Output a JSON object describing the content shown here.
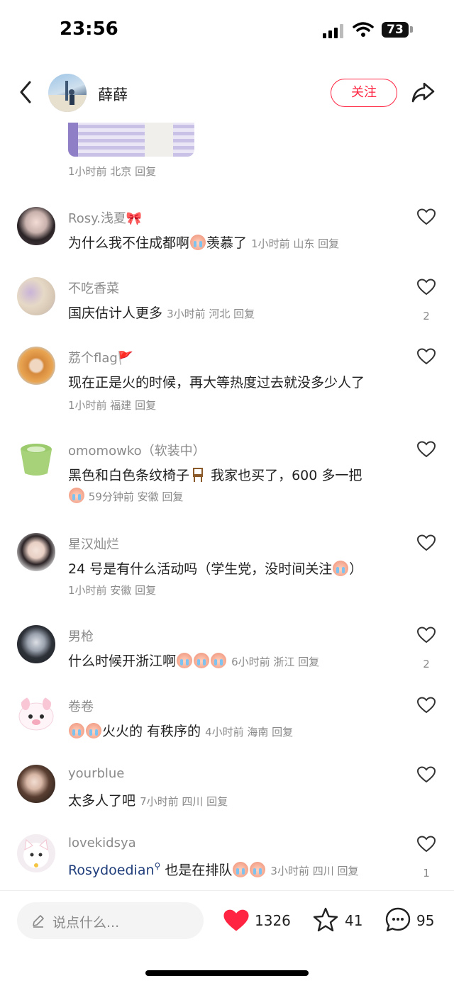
{
  "status_bar": {
    "time": "23:56",
    "battery": "73"
  },
  "header": {
    "username": "薛薛",
    "follow_label": "关注"
  },
  "previous_reply": {
    "meta": "1小时前 北京 回复"
  },
  "comments": [
    {
      "user": "Rosy.浅夏🎀",
      "text_before": "为什么我不住成都啊",
      "text_after": "羡慕了",
      "meta": "1小时前 山东 回复",
      "likes": ""
    },
    {
      "user": "不吃香菜",
      "text": "国庆估计人更多",
      "meta": "3小时前 河北 回复",
      "likes": "2"
    },
    {
      "user": "荔个flag🚩",
      "text": "现在正是火的时候，再大等热度过去就没多少人了",
      "meta": "1小时前 福建 回复",
      "likes": ""
    },
    {
      "user": "omomowko（软装中）",
      "text_before": "黑色和白色条纹椅子",
      "text_after": "我家也买了，600 多一把",
      "meta": "59分钟前 安徽 回复",
      "likes": ""
    },
    {
      "user": "星汉灿烂",
      "text_before": "24 号是有什么活动吗（学生党，没时间关注",
      "text_after": "）",
      "meta": "1小时前 安徽 回复",
      "likes": ""
    },
    {
      "user": "男枪",
      "text": "什么时候开浙江啊",
      "meta": "6小时前 浙江 回复",
      "likes": "2"
    },
    {
      "user": "卷卷",
      "text": "火火的 有秩序的",
      "meta": "4小时前 海南 回复",
      "likes": ""
    },
    {
      "user": "yourblue",
      "text": "太多人了吧",
      "meta": "7小时前 四川 回复",
      "likes": ""
    },
    {
      "user": "lovekidsya",
      "mention": "Rosydoedian",
      "text": "也是在排队",
      "meta": "3小时前 四川 回复",
      "likes": "1"
    }
  ],
  "bottom_bar": {
    "input_placeholder": "说点什么...",
    "like_count": "1326",
    "collect_count": "41",
    "comment_count": "95"
  },
  "colors": {
    "accent": "#ff2442",
    "meta_gray": "#8a8a8a",
    "mention": "#1f3d7a"
  },
  "icons": [
    "back-icon",
    "share-icon",
    "heart-outline-icon",
    "heart-filled-icon",
    "star-icon",
    "chat-bubble-icon",
    "pen-icon",
    "signal-icon",
    "wifi-icon",
    "battery-icon"
  ]
}
